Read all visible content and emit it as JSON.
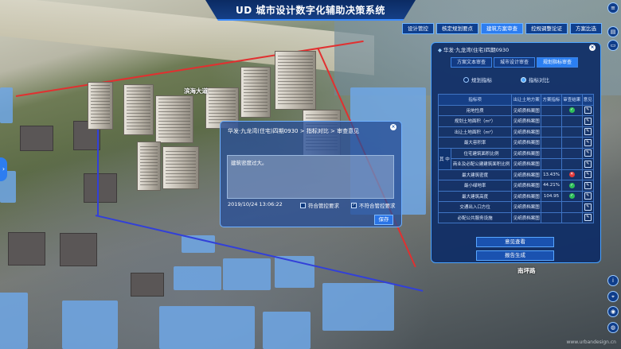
{
  "app": {
    "title": "UD 城市设计数字化辅助决策系统"
  },
  "top_nav": {
    "tabs": [
      {
        "label": "设计管控",
        "active": false
      },
      {
        "label": "核定规划要点",
        "active": false
      },
      {
        "label": "建筑方案审查",
        "active": true
      },
      {
        "label": "控规调整论证",
        "active": false
      },
      {
        "label": "方案比选",
        "active": false
      }
    ]
  },
  "map_labels": {
    "road_north": "滨海大道",
    "road_south": "南坪路"
  },
  "panel": {
    "title": "华发·九龙湾(住宅)四期0930",
    "tabs": [
      {
        "label": "方案文本审查",
        "active": false
      },
      {
        "label": "城市设计审查",
        "active": false
      },
      {
        "label": "规划指标审查",
        "active": true
      }
    ],
    "radios": [
      {
        "label": "规划指标",
        "selected": false
      },
      {
        "label": "指标对比",
        "selected": true
      }
    ],
    "columns": [
      "指标项",
      "出让土地方案",
      "方案指标",
      "审查结果",
      "意见"
    ],
    "group_label": "其 中",
    "rows": [
      {
        "item": "用地性质",
        "basis": "见纸质档案图",
        "value": "",
        "status": "ok",
        "grouped": false
      },
      {
        "item": "规划土地面积（m²）",
        "basis": "见纸质档案图",
        "value": "",
        "status": "",
        "grouped": false
      },
      {
        "item": "出让土地面积（m²）",
        "basis": "见纸质档案图",
        "value": "",
        "status": "",
        "grouped": false
      },
      {
        "item": "最大容积率",
        "basis": "见纸质档案图",
        "value": "",
        "status": "",
        "grouped": false
      },
      {
        "item": "住宅建筑面积比例",
        "basis": "见纸质档案图",
        "value": "",
        "status": "",
        "grouped": true
      },
      {
        "item": "商业及必配公建建筑面积比例",
        "basis": "见纸质档案图",
        "value": "",
        "status": "",
        "grouped": true
      },
      {
        "item": "最大建筑密度",
        "basis": "见纸质档案图",
        "value": "13.43%",
        "status": "bad",
        "grouped": false
      },
      {
        "item": "最小绿地率",
        "basis": "见纸质档案图",
        "value": "44.21%",
        "status": "ok",
        "grouped": false
      },
      {
        "item": "最大建筑高度",
        "basis": "见纸质档案图",
        "value": "104.95",
        "status": "ok",
        "grouped": false
      },
      {
        "item": "交通出入口方位",
        "basis": "见纸质档案图",
        "value": "",
        "status": "",
        "grouped": false
      },
      {
        "item": "必配公共服务设施",
        "basis": "见纸质档案图",
        "value": "",
        "status": "",
        "grouped": false
      }
    ],
    "buttons": {
      "opinion": "意见查看",
      "report": "报告生成"
    }
  },
  "dialog": {
    "breadcrumb": "华发·九龙湾(住宅)四期0930  >  指标对比  >  审查意见",
    "text": "建筑密度过大。",
    "date": "2019/10/24 13:06:22",
    "checkbox_pass": {
      "label": "符合管控要求",
      "checked": false
    },
    "checkbox_fail": {
      "label": "不符合管控要求",
      "checked": true
    },
    "save": "保存"
  },
  "watermark": "www.urbandesign.cn",
  "icons": [
    "menu-icon",
    "layers-icon",
    "info-icon",
    "navigation-icon",
    "camera-icon",
    "location-icon",
    "globe-icon"
  ]
}
